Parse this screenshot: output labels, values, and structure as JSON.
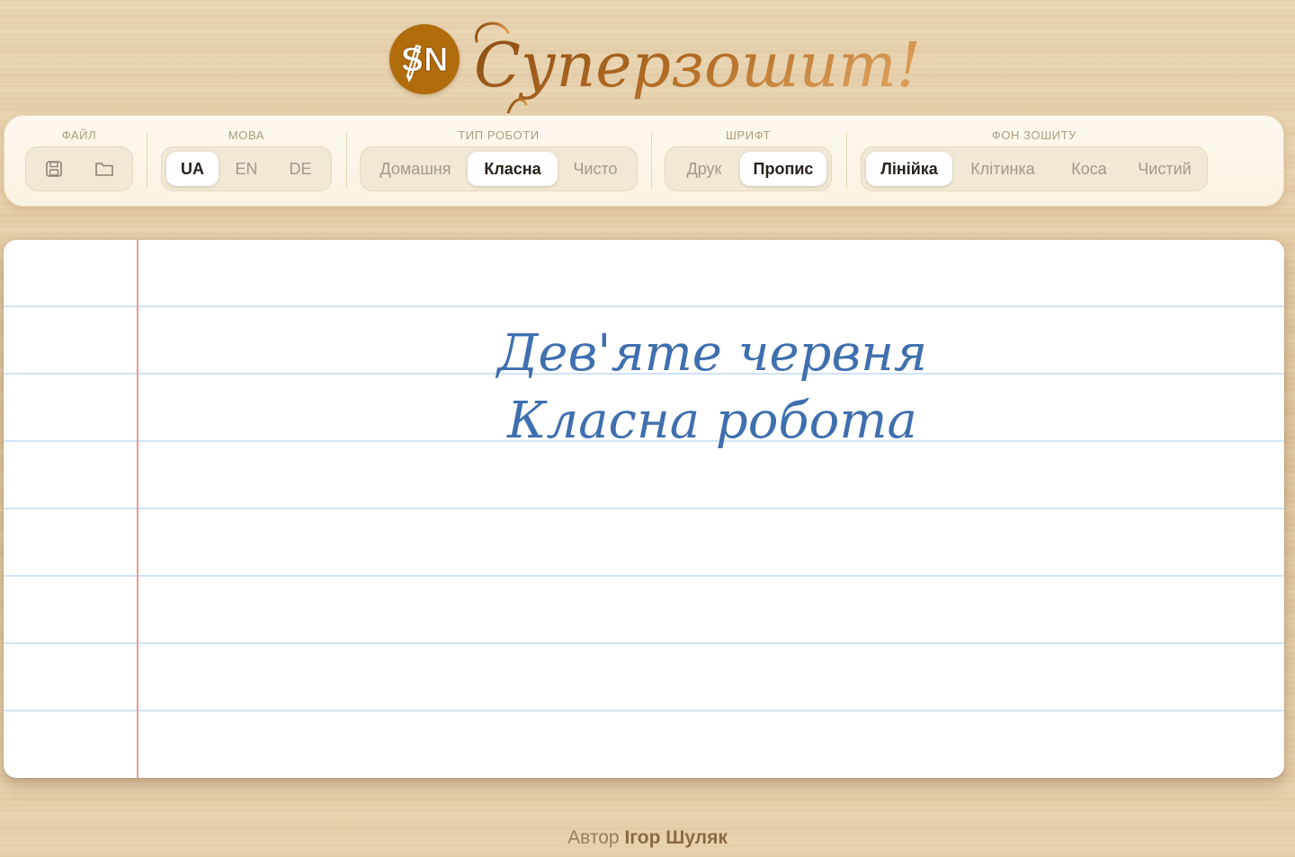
{
  "app": {
    "logo_badge_text": "SN",
    "title": "Суперзошит!"
  },
  "toolbar": {
    "file": {
      "title": "ФАЙЛ",
      "buttons": [
        "save-icon",
        "folder-icon"
      ]
    },
    "language": {
      "title": "МОВА",
      "options": [
        "UA",
        "EN",
        "DE"
      ],
      "selected": "UA"
    },
    "work_type": {
      "title": "ТИП РОБОТИ",
      "options": [
        "Домашня",
        "Класна",
        "Чисто"
      ],
      "selected": "Класна"
    },
    "font": {
      "title": "ШРИФТ",
      "options": [
        "Друк",
        "Пропис"
      ],
      "selected": "Пропис"
    },
    "background": {
      "title": "ФОН ЗОШИТУ",
      "options": [
        "Лінійка",
        "Клітинка",
        "Коса",
        "Чистий"
      ],
      "selected": "Лінійка"
    }
  },
  "notebook": {
    "line_1": "Дев'яте червня",
    "line_2": "Класна робота",
    "ink_color": "#3f6fae",
    "rule_color": "#cfe3f6",
    "margin_color": "#ee9b94"
  },
  "footer": {
    "prefix": "Автор",
    "author": "Ігор Шуляк"
  },
  "colors": {
    "accent": "#b16c0c",
    "title_gradient_start": "#8a4d14",
    "title_gradient_end": "#d89a55"
  }
}
